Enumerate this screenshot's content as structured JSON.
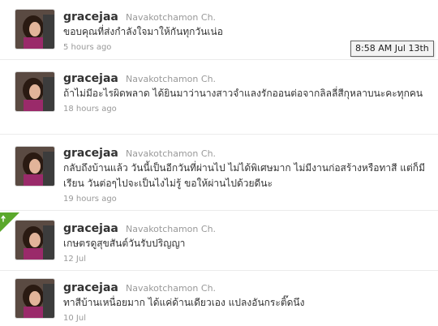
{
  "tweets": [
    {
      "screen_name": "gracejaa",
      "full_name": "Navakotchamon Ch.",
      "text": "ขอบคุณที่ส่งกำลังใจมาให้กันทุกวันเน่อ",
      "time": "5 hours ago"
    },
    {
      "screen_name": "gracejaa",
      "full_name": "Navakotchamon Ch.",
      "text": "ถ้าไม่มีอะไรผิดพลาด ได้ยินมาว่านางสาวจำแลงรักออนต่อจากลิลลี่สีกุหลาบนะคะทุกคน",
      "time": "18 hours ago"
    },
    {
      "screen_name": "gracejaa",
      "full_name": "Navakotchamon Ch.",
      "text": "กลับถึงบ้านแล้ว วันนี้เป็นอีกวันที่ผ่านไป ไม่ได้พิเศษมาก ไม่มีงานก่อสร้างหรือทาสี แต่ก็มีเรียน วันต่อๆไปจะเป็นไงไม่รู้ ขอให้ผ่านไปด้วยดีนะ",
      "time": "19 hours ago"
    },
    {
      "screen_name": "gracejaa",
      "full_name": "Navakotchamon Ch.",
      "text": "เกษตรดูสุขสันต์วันรับปริญญา",
      "time": "12 Jul"
    },
    {
      "screen_name": "gracejaa",
      "full_name": "Navakotchamon Ch.",
      "text": "ทาสีบ้านเหนื่อยมาก ได้แค่ด้านเดียวเอง แปลงอันกระติ๊ดนึง",
      "time": "10 Jul"
    }
  ],
  "tooltip": {
    "text": "8:58 AM Jul 13th"
  },
  "icons": {
    "retweet_corner": "retweet-icon",
    "avatar": "profile-photo"
  },
  "colors": {
    "name": "#333333",
    "meta": "#999999",
    "retweet_badge": "#5aa82b"
  }
}
